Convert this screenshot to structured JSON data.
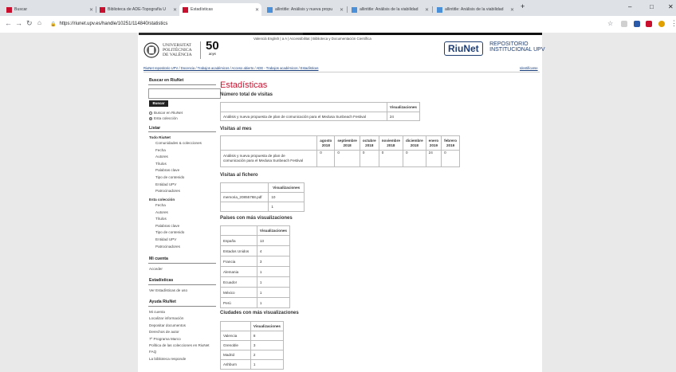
{
  "browser": {
    "tabs": [
      {
        "title": "Buscar",
        "active": false
      },
      {
        "title": "Biblioteca de ADE-Topografía U",
        "active": false
      },
      {
        "title": "Estadísticas",
        "active": true
      },
      {
        "title": "allintitle: Análisis y nueva propu",
        "active": false
      },
      {
        "title": "allintitle: Análisis de la viabilidad",
        "active": false
      },
      {
        "title": "allintitle: Análisis de la viabilidad",
        "active": false
      }
    ],
    "new_tab": "+",
    "url": "https://riunet.upv.es/handle/10251/114840/statistics",
    "win_min": "–",
    "win_max": "□",
    "win_close": "✕"
  },
  "header": {
    "top_links": "Valencià  English  |  a A  |  Accessibilitat  |  Biblioteca y Documentación Científica",
    "upv_logo_lines": [
      "UNIVERSITAT",
      "POLITÈCNICA",
      "DE VALÈNCIA"
    ],
    "anniv_number": "50",
    "anniv_word": "anys",
    "riunet": "RiuNet",
    "repo_line1": "REPOSITORIO",
    "repo_line2": "INSTITUCIONAL UPV",
    "breadcrumb": "RiuNet repositorio UPV  /  Docencia  /  Trabajos académicos  /  Acceso abierto  /  ADE - Trabajos académicos  /  Estadísticas",
    "identify": "Identificarse"
  },
  "sidebar": {
    "search_heading": "Buscar en RiuNet",
    "search_button": "Buscar",
    "radio1": "Buscar en RiuNet",
    "radio2": "Esta colección",
    "list_heading": "Listar",
    "all_heading": "Todo RiuNet",
    "all_items": [
      "Comunidades & colecciones",
      "Fecha",
      "Autores",
      "Títulos",
      "Palabras clave",
      "Tipo de contenido",
      "Entidad UPV",
      "Patrocinadores"
    ],
    "coll_heading": "Esta colección",
    "coll_items": [
      "Fecha",
      "Autores",
      "Títulos",
      "Palabras clave",
      "Tipo de contenido",
      "Entidad UPV",
      "Patrocinadores"
    ],
    "account_heading": "Mi cuenta",
    "account_items": [
      "Acceder"
    ],
    "stats_heading": "Estadísticas",
    "stats_items": [
      "Ver Estadísticas de uso"
    ],
    "help_heading": "Ayuda RiuNet",
    "help_items": [
      "Mi cuenta",
      "Localizar información",
      "Depositar documentos",
      "Derechos de autor",
      "7º Programa Marco",
      "Política de las colecciones en RiuNet",
      "FAQ",
      "La biblioteca responde"
    ]
  },
  "main": {
    "title": "Estadísticas",
    "total_heading": "Número total de visitas",
    "total_header": "Visualizaciones",
    "total_row": {
      "name": "Análisis y nueva propuesta de plan de comunicación para el Medusa Sunbeach Festival",
      "value": "24"
    },
    "monthly_heading": "Visitas al mes",
    "monthly_months": [
      {
        "m": "agosto",
        "y": "2018"
      },
      {
        "m": "septiembre",
        "y": "2018"
      },
      {
        "m": "octubre",
        "y": "2018"
      },
      {
        "m": "noviembre",
        "y": "2018"
      },
      {
        "m": "diciembre",
        "y": "2018"
      },
      {
        "m": "enero",
        "y": "2019"
      },
      {
        "m": "febrero",
        "y": "2019"
      }
    ],
    "monthly_row_l1": "Análisis y nueva propuesta de plan de",
    "monthly_row_l2": "comunicación para el Medusa Sunbeach Festival",
    "monthly_values": [
      "0",
      "0",
      "0",
      "0",
      "0",
      "24",
      "0"
    ],
    "file_heading": "Visitas al fichero",
    "file_header": "Visualizaciones",
    "file_rows": [
      {
        "name": "memoria_20855768.pdf",
        "value": "10"
      },
      {
        "name": "",
        "value": "1"
      }
    ],
    "countries_heading": "Países con más visualizaciones",
    "countries_header": "Visualizaciones",
    "countries": [
      {
        "name": "España",
        "value": "13"
      },
      {
        "name": "Estados Unidos",
        "value": "4"
      },
      {
        "name": "Francia",
        "value": "3"
      },
      {
        "name": "Alemania",
        "value": "1"
      },
      {
        "name": "Ecuador",
        "value": "1"
      },
      {
        "name": "México",
        "value": "1"
      },
      {
        "name": "Perú",
        "value": "1"
      }
    ],
    "cities_heading": "Ciudades con más visualizaciones",
    "cities_header": "Visualizaciones",
    "cities": [
      {
        "name": "Valencia",
        "value": "8"
      },
      {
        "name": "Grenoble",
        "value": "3"
      },
      {
        "name": "Madrid",
        "value": "2"
      },
      {
        "name": "Ashburn",
        "value": "1"
      }
    ]
  },
  "colors": {
    "accent_red": "#c8102e",
    "brand_blue": "#1f3e72"
  }
}
